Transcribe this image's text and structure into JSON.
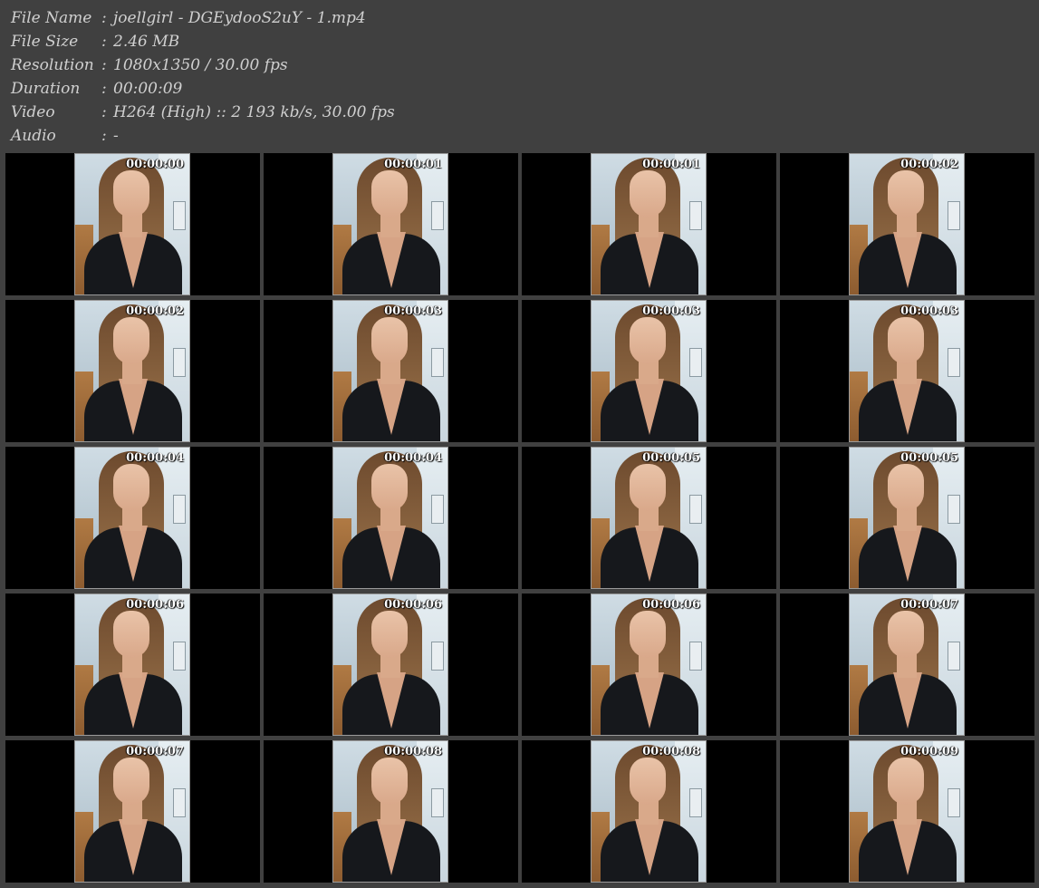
{
  "info": [
    {
      "label": "File Name",
      "value": "joellgirl - DGEydooS2uY - 1.mp4"
    },
    {
      "label": "File Size",
      "value": "2.46 MB"
    },
    {
      "label": "Resolution",
      "value": "1080x1350 / 30.00 fps"
    },
    {
      "label": "Duration",
      "value": "00:00:09"
    },
    {
      "label": "Video",
      "value": "H264 (High) :: 2 193 kb/s, 30.00 fps"
    },
    {
      "label": "Audio",
      "value": "-"
    }
  ],
  "separator": ":",
  "thumbnails": [
    "00:00:00",
    "00:00:01",
    "00:00:01",
    "00:00:02",
    "00:00:02",
    "00:00:03",
    "00:00:03",
    "00:00:03",
    "00:00:04",
    "00:00:04",
    "00:00:05",
    "00:00:05",
    "00:00:06",
    "00:00:06",
    "00:00:06",
    "00:00:07",
    "00:00:07",
    "00:00:08",
    "00:00:08",
    "00:00:09"
  ],
  "colors": {
    "background": "#404040",
    "text": "#d0d0d0",
    "cell": "#000000"
  }
}
